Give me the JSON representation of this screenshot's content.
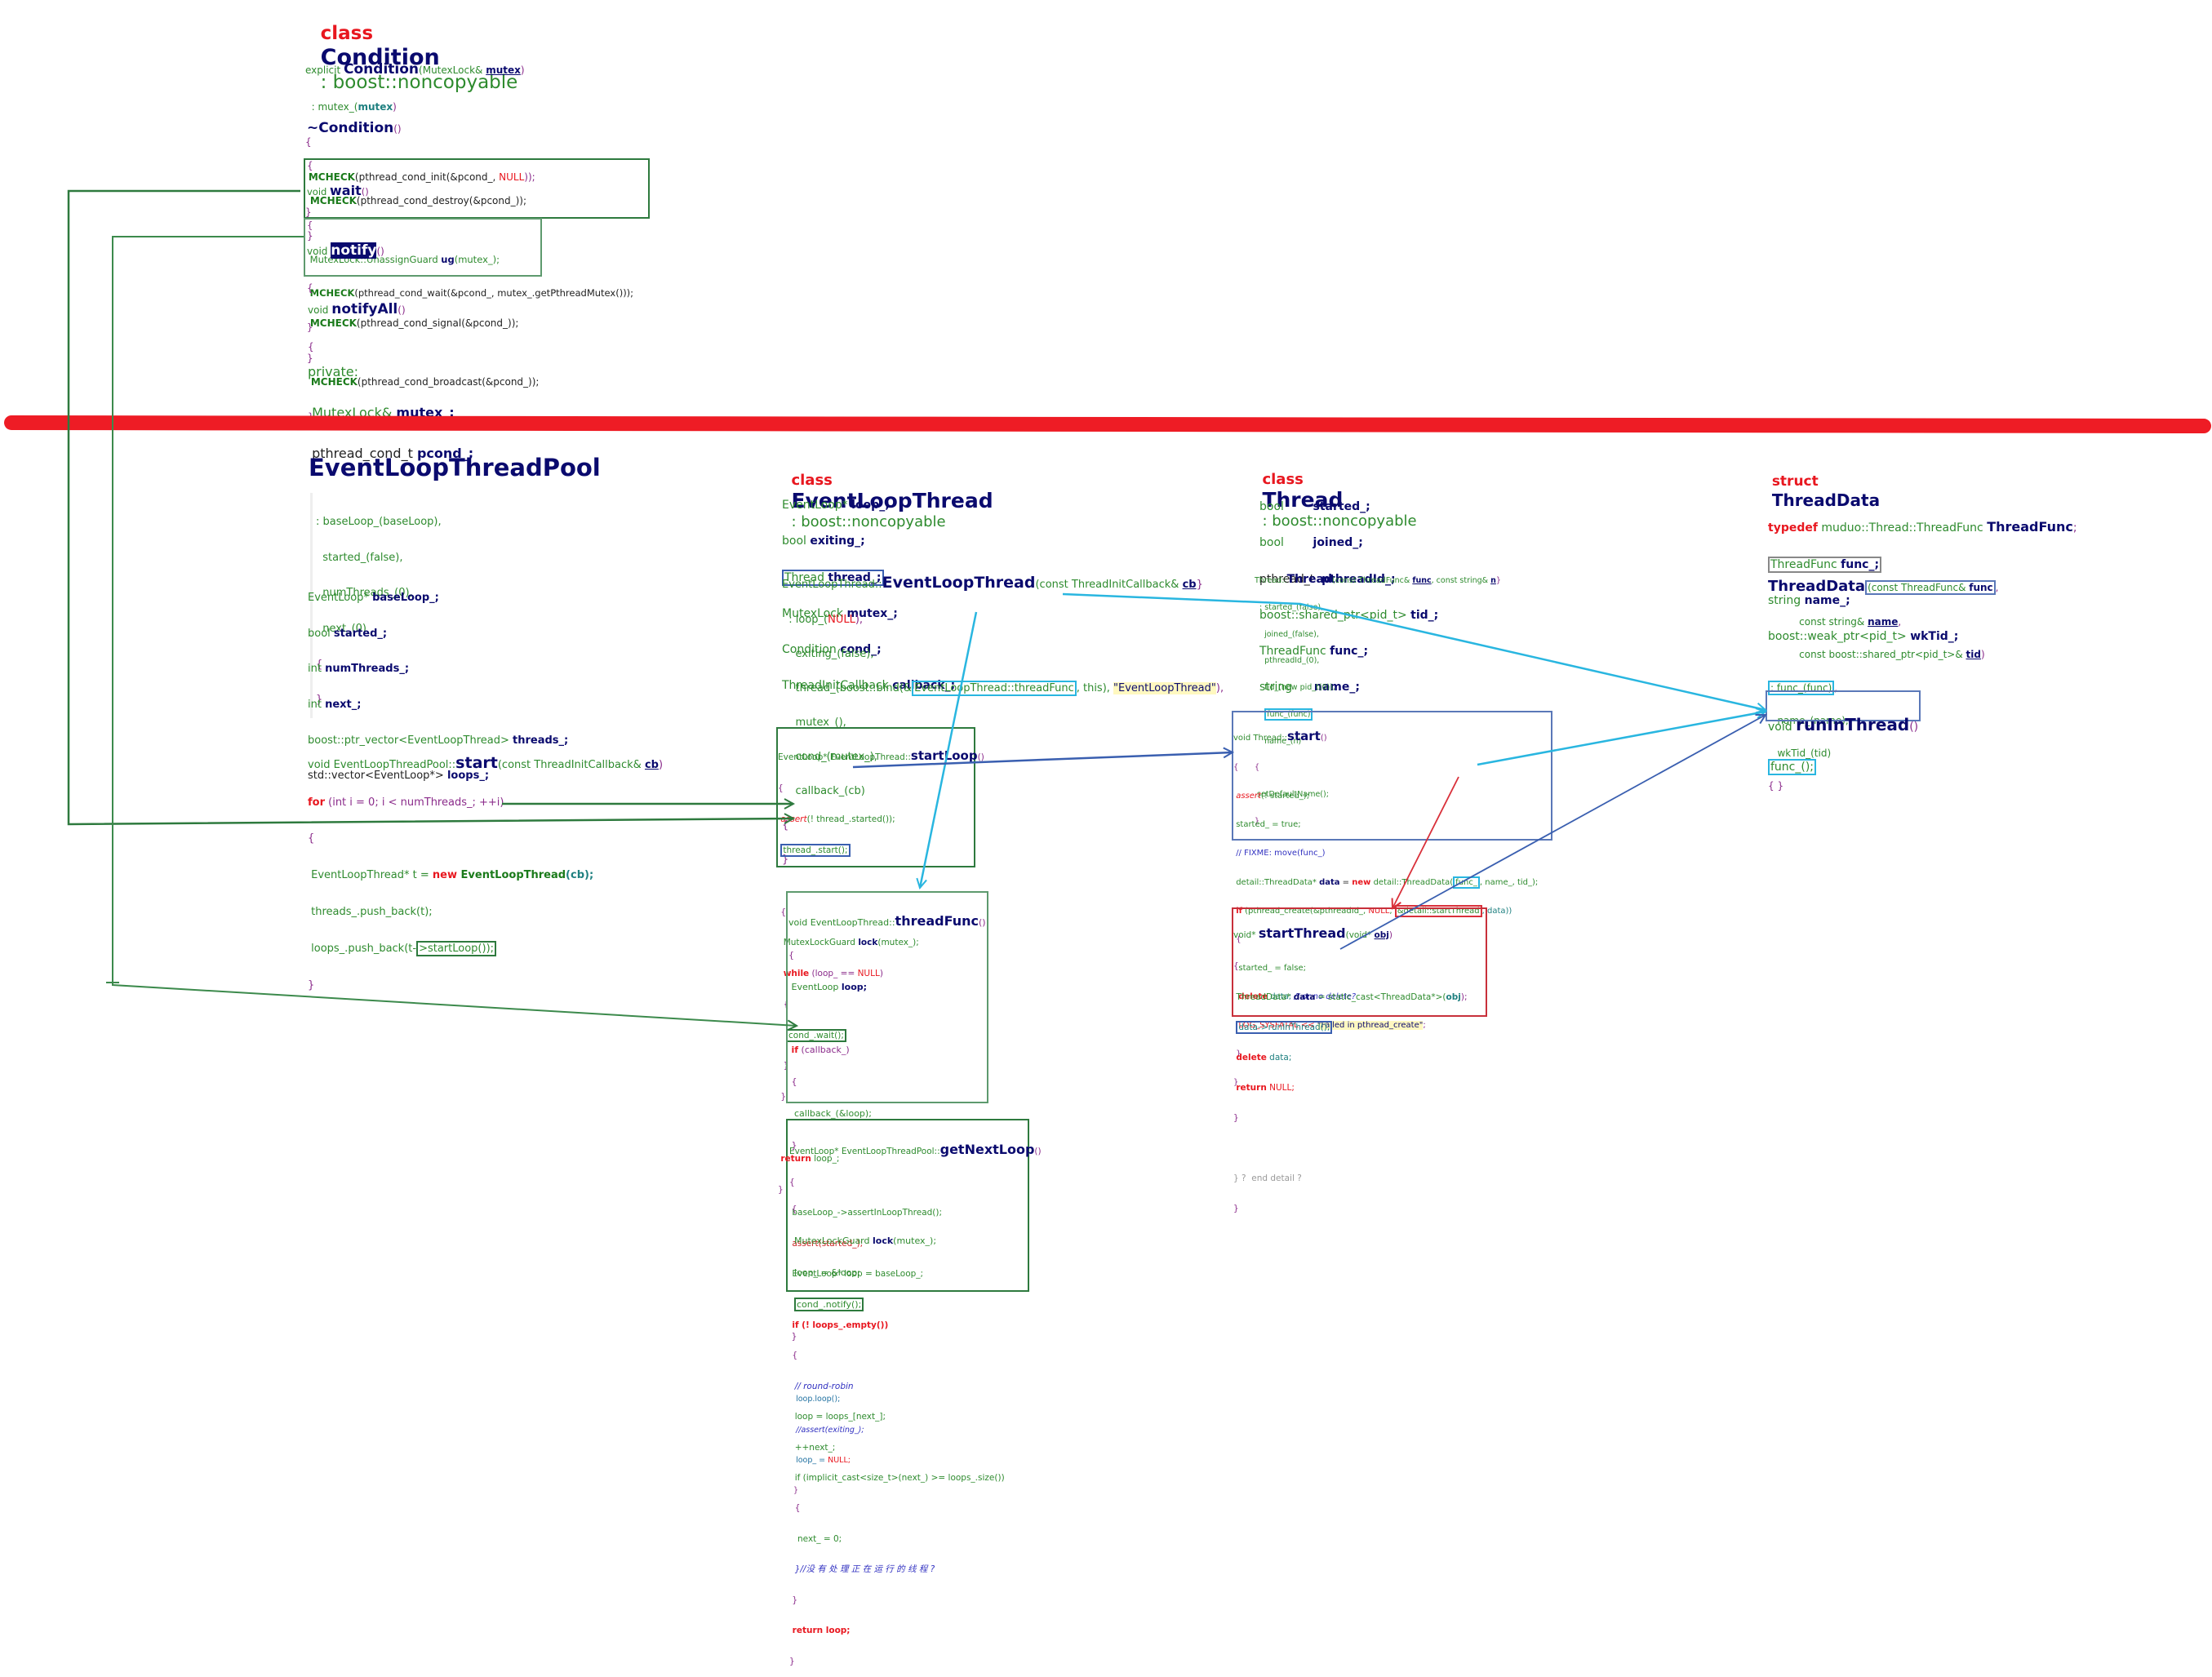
{
  "condition": {
    "header": {
      "kw": "class",
      "name": "Condition",
      "base": ": boost::noncopyable"
    },
    "ctor": {
      "kw": "explicit",
      "name": "Condition",
      "param_type": "(MutexLock& ",
      "param": "mutex",
      "close": ")",
      "init": "  : mutex_(",
      "init_arg": "mutex",
      "init_close": ")",
      "open": "{",
      "body_fn": "MCHECK",
      "body": "(pthread_cond_init(&pcond_, ",
      "body_null": "NULL",
      "body_end": "));",
      "close_brace": "}"
    },
    "dtor": {
      "name": "~Condition",
      "parens": "()",
      "open": "{",
      "body_fn": "MCHECK",
      "body": "(pthread_cond_destroy(&pcond_));",
      "close": "}"
    },
    "wait": {
      "ret": "void",
      "name": "wait",
      "parens": "()",
      "open": "{",
      "line1_type": "MutexLock::UnassignGuard ",
      "line1_name": "ug",
      "line1_rest": "(mutex_);",
      "body_fn": "MCHECK",
      "body": "(pthread_cond_wait(&pcond_, mutex_.getPthreadMutex()));",
      "close": "}"
    },
    "notify": {
      "ret": "void",
      "name": "notify",
      "parens": "()",
      "open": "{",
      "body_fn": "MCHECK",
      "body": "(pthread_cond_signal(&pcond_));",
      "close": "}"
    },
    "notifyAll": {
      "ret": "void",
      "name": "notifyAll",
      "parens": "()",
      "open": "{",
      "body_fn": "MCHECK",
      "body": "(pthread_cond_broadcast(&pcond_));",
      "close": "}"
    },
    "private": {
      "label": "private:",
      "m1_type": "MutexLock& ",
      "m1_name": "mutex_;",
      "m2_type": "pthread_cond_t ",
      "m2_name": "pcond_;"
    }
  },
  "pool": {
    "title": "EventLoopThreadPool",
    "init": [
      ": baseLoop_(baseLoop),",
      "started_(false),",
      "numThreads_(0),",
      "next_(0)",
      "{",
      "}"
    ],
    "members": [
      {
        "type": "EventLoop* ",
        "name": "baseLoop_;"
      },
      {
        "type": "bool ",
        "name": "started_;"
      },
      {
        "type": "int ",
        "name": "numThreads_;"
      },
      {
        "type": "int ",
        "name": "next_;"
      },
      {
        "type": "boost::ptr_vector<EventLoopThread> ",
        "name": "threads_;"
      },
      {
        "type": "std::vector<EventLoop*> ",
        "name": "loops_;"
      }
    ],
    "start": {
      "sig_pre": "void EventLoopThreadPool::",
      "sig_name": "start",
      "sig_params": "(const ThreadInitCallback& ",
      "sig_param": "cb",
      "sig_close": ")",
      "for_kw": "for",
      "for_rest": " (int i = 0; i < numThreads_; ++i)",
      "open": "{",
      "l1": "EventLoopThread* t = ",
      "l1_kw": "new",
      "l1_ctor": " EventLoopThread",
      "l1_end": "(cb);",
      "l2": "threads_.push_back(t);",
      "l3": "loops_.push_back(t-",
      "l3_hl": ">startLoop());",
      "close": "}"
    },
    "getNextLoop": {
      "sig_pre": "EventLoop* EventLoopThreadPool::",
      "sig_name": "getNextLoop",
      "sig_close": "()",
      "lines": [
        "{",
        "baseLoop_->assertInLoopThread();",
        "assert(started_);",
        "EventLoop* loop = baseLoop_;",
        "",
        "if (! loops_.empty())",
        "{",
        "// round-robin",
        "loop = loops_[next_];",
        "++next_;",
        "if (implicit_cast<size_t>(next_) >= loops_.size())",
        "{",
        "next_ = 0;",
        "}//没 有 处 理 正 在 运 行 的 线 程 ?",
        "}",
        "return loop;",
        "}"
      ]
    }
  },
  "eventLoopThread": {
    "header": {
      "kw": "class",
      "name": "EventLoopThread",
      "base": ": boost::noncopyable"
    },
    "members": [
      {
        "type": "EventLoop* ",
        "name": "loop_;"
      },
      {
        "type": "bool ",
        "name": "exiting_;"
      },
      {
        "type": "Thread ",
        "name": "thread_;"
      },
      {
        "type": "MutexLock ",
        "name": "mutex_;"
      },
      {
        "type": "Condition ",
        "name": "cond_;"
      },
      {
        "type": "ThreadInitCallback ",
        "name": "callback_;"
      }
    ],
    "ctor": {
      "pre": "EventLoopThread::",
      "name": "EventLoopThread",
      "params": "(const ThreadInitCallback& ",
      "param": "cb",
      "close": "}",
      "l1": "  : loop_(",
      "l1_null": "NULL",
      "l1_end": "),",
      "l2": "    exiting_(false),",
      "l3_pre": "    thread_(boost::bind(&",
      "l3_hl": "EventLoopThread::threadFunc",
      "l3_mid": ", this), ",
      "l3_str": "\"EventLoopThread\"",
      "l3_end": "),",
      "l4": "    mutex_(),",
      "l5": "    cond_(mutex_),",
      "l6": "    callback_(cb)",
      "open": "{"
    },
    "startLoop": {
      "sig_pre": "EventLoop* EventLoopThread::",
      "sig_name": "startLoop",
      "sig_close": "()",
      "open": "{",
      "l1_kw": "assert",
      "l1": "(! thread_.started());",
      "l2_hl": "thread_.start();",
      "l3": "{",
      "l4": "MutexLockGuard ",
      "l4_name": "lock",
      "l4_end": "(mutex_);",
      "l5_kw": "while",
      "l5": " (loop_ == ",
      "l5_null": "NULL",
      "l5_end": ")",
      "l6": "{",
      "l7_hl": "cond_.wait();",
      "l8": "}",
      "l9": "}",
      "ret_kw": "return",
      "ret": " loop_;",
      "close": "}"
    },
    "threadFunc": {
      "sig_pre": "void EventLoopThread::",
      "sig_name": "threadFunc",
      "sig_close": "()",
      "open": "{",
      "l1": "EventLoop ",
      "l1_name": "loop;",
      "l2_kw": "if",
      "l2": " (callback_)",
      "l3": "{",
      "l4": "callback_(&loop);",
      "l5": "}",
      "l6": "{",
      "l7": "MutexLockGuard ",
      "l7_name": "lock",
      "l7_end": "(mutex_);",
      "l8": "loop_ = &loop;",
      "l9_hl": "cond_.notify();",
      "l10": "}",
      "l11": "loop.loop();",
      "l12": "//assert(exiting_);",
      "l13": "loop_ = ",
      "l13_null": "NULL;",
      "close": "}"
    }
  },
  "thread": {
    "header": {
      "kw": "class",
      "name": "Thread",
      "base": ": boost::noncopyable"
    },
    "members": [
      {
        "type": "bool        ",
        "name": "started_;"
      },
      {
        "type": "bool        ",
        "name": "joined_;"
      },
      {
        "type": "pthread_t  ",
        "name": "pthreadId_;"
      },
      {
        "type": "boost::shared_ptr<pid_t> ",
        "name": "tid_;"
      },
      {
        "type": "ThreadFunc ",
        "name": "func_;"
      },
      {
        "type": "string      ",
        "name": "name_;"
      }
    ],
    "ctor": {
      "pre": "Thread::",
      "name": "Thread",
      "params": "(const ThreadFunc& ",
      "p1": "func",
      "mid": ", const string& ",
      "p2": "n",
      "close": "}",
      "lines": [
        ": started_(false),",
        "  joined_(false),",
        "  pthreadId_(0),",
        "  tid_(new pid_t(0)),"
      ],
      "hl": "func_(func)",
      "l_name": "  name_(n)",
      "open": "{",
      "body": "setDefaultName();"
    },
    "start": {
      "sig_pre": "void Thread::",
      "sig_name": "start",
      "sig_close": "()",
      "open": "{",
      "l1_kw": "assert",
      "l1": "(! started_);",
      "l2": "started_ = true;",
      "l3": "// FIXME: move(func_)",
      "l4_pre": "detail::ThreadData* ",
      "l4_name": "data",
      "l4_eq": " = ",
      "l4_kw": "new",
      "l4_type": " detail::ThreadData(",
      "l4_hl": "func_",
      "l4_end": ", name_, tid_);",
      "l5_kw": "if",
      "l5": " (pthread_create(&pthreadId_, ",
      "l5_null": "NULL",
      "l5_sep": ", ",
      "l5_hl": "&detail::startThread",
      "l5_end": ", data))",
      "l6": "{",
      "l7": "started_ = false;",
      "l8_kw": "delete",
      "l8": " data; ",
      "l8_cm": "// or no delete?",
      "l9": "LOG_SYSFATAL << ",
      "l9_str": "\"Failed in pthread_create\"",
      "l9_end": ";",
      "l10": "}",
      "close": "}"
    },
    "startThread": {
      "sig_pre": "void* ",
      "sig_name": "startThread",
      "sig_params": "(void* ",
      "sig_param": "obj",
      "sig_close": ")",
      "open": "{",
      "l1": "ThreadData* ",
      "l1_name": "data",
      "l1_rest": " = static_cast<ThreadData*>(",
      "l1_arg": "obj",
      "l1_end": ");",
      "l2_hl": "data->runInThread();",
      "l3_kw": "delete",
      "l3": " data;",
      "l4_kw": "return",
      "l4": " NULL;",
      "close": "}",
      "end_comment": "} ?  end detail ?",
      "final": "}"
    }
  },
  "threadData": {
    "header": {
      "kw": "struct",
      "name": "ThreadData"
    },
    "typedef": {
      "kw": "typedef",
      "type": " muduo::Thread::ThreadFunc ",
      "name": "ThreadFunc",
      "end": ";"
    },
    "members": [
      {
        "type": "ThreadFunc ",
        "name": "func_;"
      },
      {
        "type": "string ",
        "name": "name_;"
      },
      {
        "type": "boost::weak_ptr<pid_t> ",
        "name": "wkTid_;"
      }
    ],
    "ctor": {
      "name": "ThreadData",
      "p1_type": "(const ThreadFunc& ",
      "p1": "func",
      "p1_end": ",",
      "p2_type": "const string& ",
      "p2": "name",
      "p2_end": ",",
      "p3_type": "const boost::shared_ptr<pid_t>& ",
      "p3": "tid",
      "p3_end": ")",
      "init_hl": ": func_(func)",
      "init_hl_end": ",",
      "init2": "name_(name),",
      "init3": "wkTid_(tid)",
      "body": "{ }"
    },
    "runInThread": {
      "ret": "void ",
      "name": "runInThread",
      "parens": "()",
      "body_hl": "func_();"
    }
  },
  "colors": {
    "separator": "#ee1c25",
    "green_arrow": "#2e7a3e",
    "cyan_arrow": "#29b6e0",
    "blue_arrow": "#3a5fb0",
    "red_arrow": "#d9303a"
  }
}
